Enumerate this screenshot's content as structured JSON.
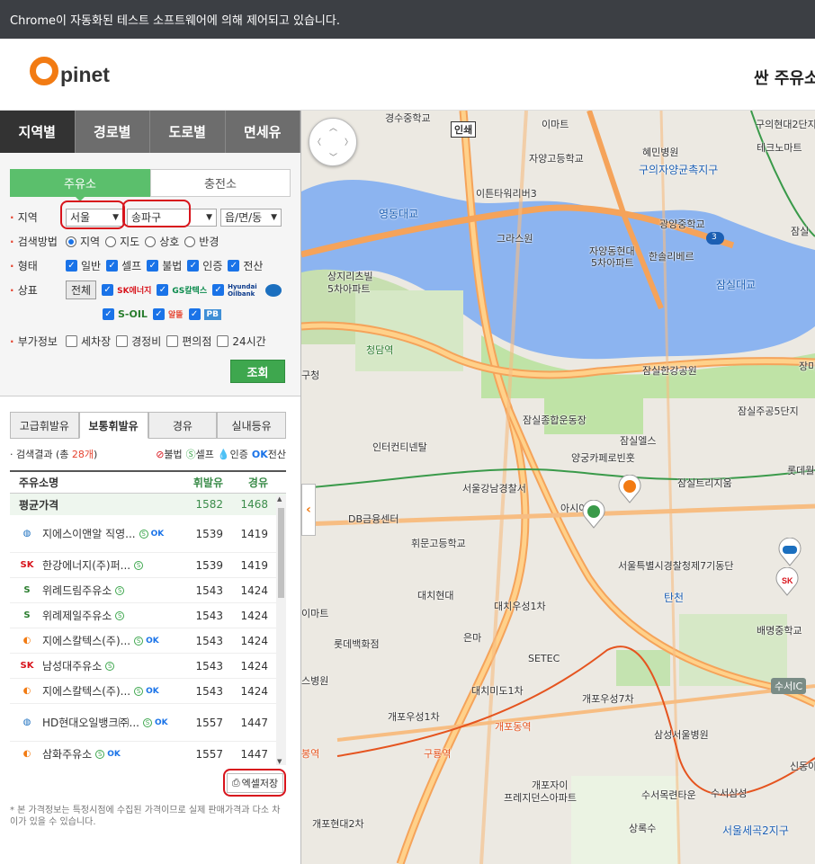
{
  "browser": {
    "automation_notice": "Chrome이 자동화된 테스트 소프트웨어에 의해 제어되고 있습니다."
  },
  "header": {
    "logo_text": "pinet",
    "right_title": "싼 주유소"
  },
  "main_tabs": [
    "지역별",
    "경로별",
    "도로별",
    "면세유"
  ],
  "sub_tabs": [
    "주유소",
    "충전소"
  ],
  "search": {
    "region_label": "지역",
    "sido": "서울",
    "sigungu": "송파구",
    "dong": "읍/면/동",
    "method_label": "검색방법",
    "methods": [
      "지역",
      "지도",
      "상호",
      "반경"
    ],
    "type_label": "형태",
    "types": [
      "일반",
      "셀프",
      "불법",
      "인증",
      "전산"
    ],
    "brand_label": "상표",
    "brand_all": "전체",
    "brands": [
      "SK에너지",
      "GS칼텍스",
      "Hyundai Oilbank",
      "S-OIL",
      "알뜰",
      "PB"
    ],
    "extra_label": "부가정보",
    "extras": [
      "세차장",
      "경정비",
      "편의점",
      "24시간"
    ],
    "submit": "조회"
  },
  "fuel_tabs": [
    "고급휘발유",
    "보통휘발유",
    "경유",
    "실내등유"
  ],
  "result": {
    "prefix": "검색결과 (총 ",
    "count": "28개",
    "suffix": ")",
    "legend": [
      "불법",
      "셀프",
      "인증",
      "전산"
    ]
  },
  "table": {
    "headers": [
      "주유소명",
      "휘발유",
      "경유"
    ],
    "avg": {
      "label": "평균가격",
      "gasoline": "1582",
      "diesel": "1468"
    },
    "rows": [
      {
        "name": "지에스이앤알 직영...",
        "brand": "HD",
        "gasoline": "1539",
        "diesel": "1419"
      },
      {
        "name": "한강에너지(주)퍼...",
        "brand": "SK",
        "gasoline": "1539",
        "diesel": "1419"
      },
      {
        "name": "위례드림주유소",
        "brand": "S",
        "gasoline": "1543",
        "diesel": "1424"
      },
      {
        "name": "위례제일주유소",
        "brand": "S",
        "gasoline": "1543",
        "diesel": "1424"
      },
      {
        "name": "지에스칼텍스(주)...",
        "brand": "GS",
        "gasoline": "1543",
        "diesel": "1424"
      },
      {
        "name": "남성대주유소",
        "brand": "SK",
        "gasoline": "1543",
        "diesel": "1424"
      },
      {
        "name": "지에스칼텍스(주)...",
        "brand": "GS",
        "gasoline": "1543",
        "diesel": "1424"
      },
      {
        "name": "HD현대오일뱅크㈜...",
        "brand": "HD",
        "gasoline": "1557",
        "diesel": "1447"
      },
      {
        "name": "삼화주유소",
        "brand": "GS",
        "gasoline": "1557",
        "diesel": "1447"
      }
    ]
  },
  "excel_button": "엑셀저장",
  "note": "* 본 가격정보는 특정시점에 수집된 가격이므로 실제 판매가격과 다소 차이가 있을 수 있습니다.",
  "map": {
    "labels": {
      "l1": "경수중학교",
      "l2": "인쇄",
      "l3": "이마트",
      "l4": "혜민병원",
      "l5": "구의현대2단지",
      "l6": "테크노마트",
      "l7": "자양고등학교",
      "l8": "구의자양균촉지구",
      "l9": "이튼타워리버3",
      "l10": "영동대교",
      "l11": "광양중학교",
      "l12": "잠실",
      "l13": "그라스원",
      "l14": "자양동현대",
      "l15": "5차아파트",
      "l16": "한솔리베르",
      "l17": "상지리츠빌",
      "l18": "5차아파트",
      "l19": "잠실대교",
      "l20": "청담역",
      "l21": "잠실한강공원",
      "l22": "구청",
      "l23": "장미",
      "l24": "잠실종합운동장",
      "l25": "잠실주공5단지",
      "l26": "인터컨티넨탈",
      "l27": "잠실엘스",
      "l28": "양궁카페로빈훗",
      "l29": "롯데월",
      "l30": "서울강남경찰서",
      "l31": "잠실트리지움",
      "l32": "아시아",
      "l33": "DB금융센터",
      "l34": "휘문고등학교",
      "l35": "서울특별시경찰청제7기동단",
      "l36": "대치현대",
      "l37": "탄천",
      "l38": "대치우성1차",
      "l39": "이마트",
      "l40": "배명중학교",
      "l41": "롯데백화점",
      "l42": "은마",
      "l43": "SETEC",
      "l44": "스병원",
      "l45": "대치미도1차",
      "l46": "개포우성7차",
      "l47": "수서IC",
      "l48": "개포우성1차",
      "l49": "개포동역",
      "l50": "삼성서울병원",
      "l51": "구룡역",
      "l52": "봉역",
      "l53": "신동아",
      "l54": "개포자이",
      "l55": "프레지던스아파트",
      "l56": "수서목련타운",
      "l57": "수서삼성",
      "l58": "개포현대2차",
      "l59": "상록수",
      "l60": "서울세곡2지구",
      "l61": "3"
    }
  },
  "colors": {
    "accent_green": "#3ea74e",
    "orange": "#f27b13",
    "road": "#f5a35a",
    "water": "#8cb4f0",
    "park": "#bfe3a6"
  }
}
